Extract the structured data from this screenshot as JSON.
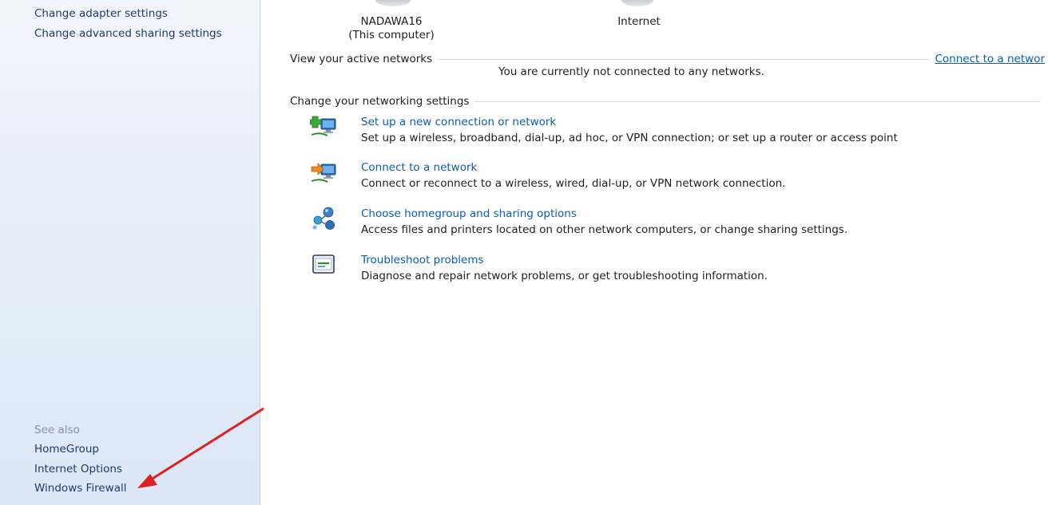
{
  "sidebar": {
    "links_top": [
      "Change adapter settings",
      "Change advanced sharing settings"
    ],
    "see_also_heading": "See also",
    "see_also_links": [
      "HomeGroup",
      "Internet Options",
      "Windows Firewall"
    ]
  },
  "network_map": {
    "computer_name": "NADAWA16",
    "computer_sub": "(This computer)",
    "internet_label": "Internet"
  },
  "active_networks": {
    "heading": "View your active networks",
    "link": "Connect to a networ",
    "status": "You are currently not connected to any networks."
  },
  "change_settings": {
    "heading": "Change your networking settings",
    "tasks": [
      {
        "title": "Set up a new connection or network",
        "description": "Set up a wireless, broadband, dial-up, ad hoc, or VPN connection; or set up a router or access point",
        "icon": "new-connection-icon"
      },
      {
        "title": "Connect to a network",
        "description": "Connect or reconnect to a wireless, wired, dial-up, or VPN network connection.",
        "icon": "connect-network-icon"
      },
      {
        "title": "Choose homegroup and sharing options",
        "description": "Access files and printers located on other network computers, or change sharing settings.",
        "icon": "homegroup-icon"
      },
      {
        "title": "Troubleshoot problems",
        "description": "Diagnose and repair network problems, or get troubleshooting information.",
        "icon": "troubleshoot-icon"
      }
    ]
  },
  "colors": {
    "link": "#0a5db5",
    "sidebar_link": "#1e3a6e",
    "sidebar_bg": "#e6eef9",
    "annotation_arrow": "#e02020"
  }
}
